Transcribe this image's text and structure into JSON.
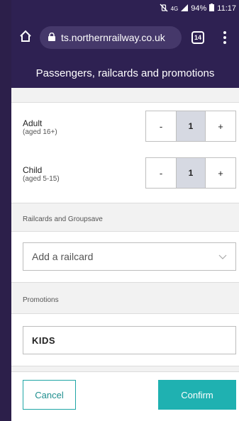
{
  "status_bar": {
    "mute_icon": "vibrate-off-icon",
    "network": "4G",
    "signal_icon": "signal-icon",
    "battery": "94%",
    "battery_icon": "battery-icon",
    "time": "11:17"
  },
  "browser": {
    "url": "ts.northernrailway.co.uk",
    "tab_count": "14"
  },
  "header": {
    "title": "Passengers, railcards and promotions"
  },
  "passengers": [
    {
      "type": "Adult",
      "age_range": "(aged 16+)",
      "count": "1",
      "minus_label": "-",
      "plus_label": "+"
    },
    {
      "type": "Child",
      "age_range": "(aged 5-15)",
      "count": "1",
      "minus_label": "-",
      "plus_label": "+"
    }
  ],
  "railcards": {
    "section_label": "Railcards and Groupsave",
    "select_value": "Add a railcard"
  },
  "promotions": {
    "section_label": "Promotions",
    "code_value": "KIDS"
  },
  "actions": {
    "cancel_label": "Cancel",
    "confirm_label": "Confirm"
  },
  "colors": {
    "header_bg": "#2e2152",
    "accent_teal": "#1fb1b1",
    "stepper_value_bg": "#d6d9e2"
  }
}
